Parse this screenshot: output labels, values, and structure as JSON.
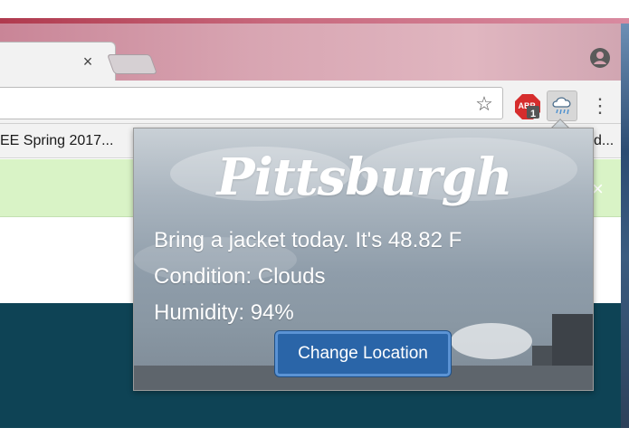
{
  "browser": {
    "tab_close_glyph": "×",
    "bookmarks": {
      "left_item": "EE Spring 2017...",
      "right_item": "d..."
    },
    "extensions": {
      "adblock_badge": "1",
      "adblock_label": "ABP"
    },
    "menu_glyph": "⋮",
    "star_glyph": "☆"
  },
  "page": {
    "banner_close_glyph": "×"
  },
  "popup": {
    "city": "Pittsburgh",
    "advice": "Bring a jacket today. It's 48.82 F",
    "condition": "Condition: Clouds",
    "humidity": "Humidity: 94%",
    "change_location_label": "Change Location"
  },
  "colors": {
    "button_blue": "#2a65a8",
    "banner_green": "#d9f3c6",
    "page_dark_teal": "#0e4355"
  }
}
